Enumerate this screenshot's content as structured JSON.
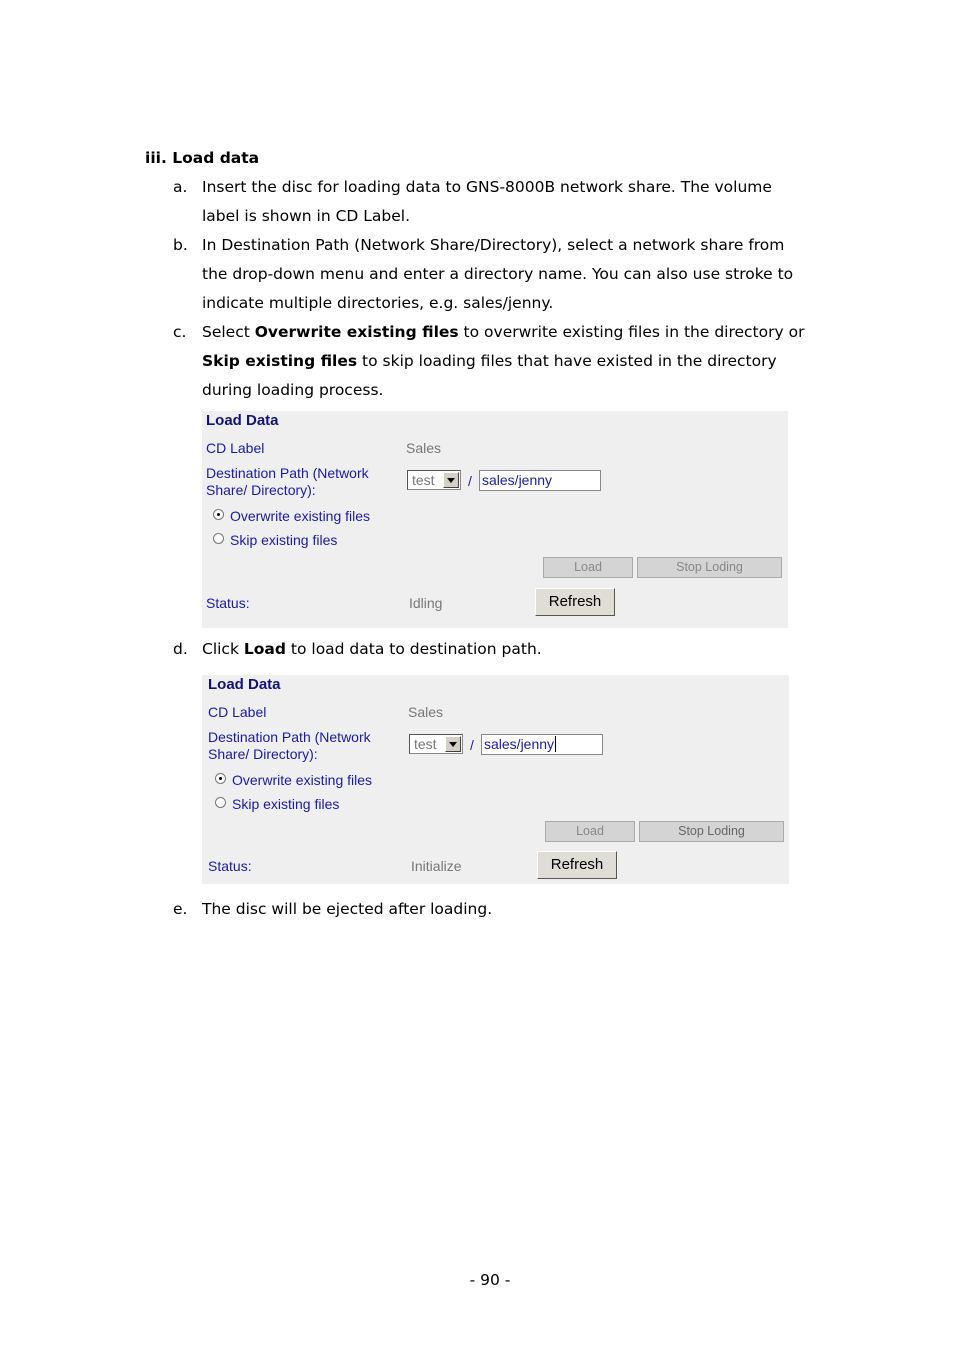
{
  "section": {
    "heading": "iii. Load data"
  },
  "steps": [
    {
      "marker": "a.",
      "text": "Insert the disc for loading data to GNS-8000B network share.  The volume label is shown in CD Label."
    },
    {
      "marker": "b.",
      "text": "In Destination Path (Network Share/Directory), select a network share from the drop-down menu and enter a directory name.  You can also use stroke to indicate multiple directories, e.g. sales/jenny."
    },
    {
      "marker": "c.",
      "pre": "Select ",
      "bold1": "Overwrite existing files",
      "mid": " to overwrite existing files in the directory or ",
      "bold2": "Skip existing files",
      "post": " to skip loading files that have existed in the directory during loading process."
    },
    {
      "marker": "d.",
      "pre": "Click ",
      "bold1": "Load",
      "post": " to load data to destination path."
    },
    {
      "marker": "e.",
      "text": "The disc will be ejected after loading."
    }
  ],
  "panels": [
    {
      "title": "Load Data",
      "cd_label_label": "CD Label",
      "cd_label_value": "Sales",
      "dest_label_line1": "Destination Path (Network",
      "dest_label_line2": "Share/ Directory):",
      "share_select": "test",
      "slash": "/",
      "directory_value": "sales/jenny",
      "radio_overwrite": "Overwrite existing files",
      "radio_skip": "Skip existing files",
      "load_button": "Load",
      "stop_button": "Stop Loding",
      "status_label": "Status:",
      "status_value": "Idling",
      "refresh_button": "Refresh"
    },
    {
      "title": "Load Data",
      "cd_label_label": "CD Label",
      "cd_label_value": "Sales",
      "dest_label_line1": "Destination Path (Network",
      "dest_label_line2": "Share/ Directory):",
      "share_select": "test",
      "slash": "/",
      "directory_value": "sales/jenny",
      "radio_overwrite": "Overwrite existing files",
      "radio_skip": "Skip existing files",
      "load_button": "Load",
      "stop_button": "Stop Loding",
      "status_label": "Status:",
      "status_value": "Initialize",
      "refresh_button": "Refresh"
    }
  ],
  "page_number": "- 90 -"
}
